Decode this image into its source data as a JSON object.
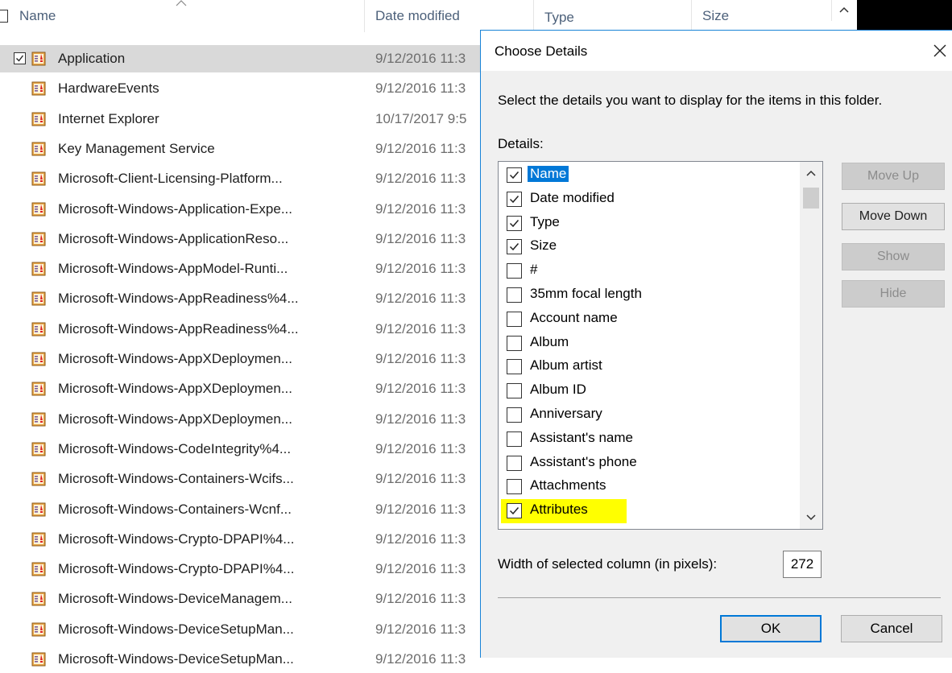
{
  "explorer": {
    "columns": {
      "name": "Name",
      "date_modified": "Date modified",
      "type": "Type",
      "size": "Size"
    },
    "icon_name": "event-log-icon",
    "files": [
      {
        "name": "Application",
        "date": "9/12/2016 11:3",
        "selected": true
      },
      {
        "name": "HardwareEvents",
        "date": "9/12/2016 11:3"
      },
      {
        "name": "Internet Explorer",
        "date": "10/17/2017 9:5"
      },
      {
        "name": "Key Management Service",
        "date": "9/12/2016 11:3"
      },
      {
        "name": "Microsoft-Client-Licensing-Platform...",
        "date": "9/12/2016 11:3"
      },
      {
        "name": "Microsoft-Windows-Application-Expe...",
        "date": "9/12/2016 11:3"
      },
      {
        "name": "Microsoft-Windows-ApplicationReso...",
        "date": "9/12/2016 11:3"
      },
      {
        "name": "Microsoft-Windows-AppModel-Runti...",
        "date": "9/12/2016 11:3"
      },
      {
        "name": "Microsoft-Windows-AppReadiness%4...",
        "date": "9/12/2016 11:3"
      },
      {
        "name": "Microsoft-Windows-AppReadiness%4...",
        "date": "9/12/2016 11:3"
      },
      {
        "name": "Microsoft-Windows-AppXDeploymen...",
        "date": "9/12/2016 11:3"
      },
      {
        "name": "Microsoft-Windows-AppXDeploymen...",
        "date": "9/12/2016 11:3"
      },
      {
        "name": "Microsoft-Windows-AppXDeploymen...",
        "date": "9/12/2016 11:3"
      },
      {
        "name": "Microsoft-Windows-CodeIntegrity%4...",
        "date": "9/12/2016 11:3"
      },
      {
        "name": "Microsoft-Windows-Containers-Wcifs...",
        "date": "9/12/2016 11:3"
      },
      {
        "name": "Microsoft-Windows-Containers-Wcnf...",
        "date": "9/12/2016 11:3"
      },
      {
        "name": "Microsoft-Windows-Crypto-DPAPI%4...",
        "date": "9/12/2016 11:3"
      },
      {
        "name": "Microsoft-Windows-Crypto-DPAPI%4...",
        "date": "9/12/2016 11:3"
      },
      {
        "name": "Microsoft-Windows-DeviceManagem...",
        "date": "9/12/2016 11:3"
      },
      {
        "name": "Microsoft-Windows-DeviceSetupMan...",
        "date": "9/12/2016 11:3"
      },
      {
        "name": "Microsoft-Windows-DeviceSetupMan...",
        "date": "9/12/2016 11:3"
      }
    ]
  },
  "dialog": {
    "title": "Choose Details",
    "instruction": "Select the details you want to display for the items in this folder.",
    "details_label": "Details:",
    "items": [
      {
        "label": "Name",
        "checked": true,
        "selected": true
      },
      {
        "label": "Date modified",
        "checked": true
      },
      {
        "label": "Type",
        "checked": true
      },
      {
        "label": "Size",
        "checked": true
      },
      {
        "label": "#",
        "checked": false
      },
      {
        "label": "35mm focal length",
        "checked": false
      },
      {
        "label": "Account name",
        "checked": false
      },
      {
        "label": "Album",
        "checked": false
      },
      {
        "label": "Album artist",
        "checked": false
      },
      {
        "label": "Album ID",
        "checked": false
      },
      {
        "label": "Anniversary",
        "checked": false
      },
      {
        "label": "Assistant's name",
        "checked": false
      },
      {
        "label": "Assistant's phone",
        "checked": false
      },
      {
        "label": "Attachments",
        "checked": false
      },
      {
        "label": "Attributes",
        "checked": true,
        "highlighted": true
      }
    ],
    "buttons": {
      "move_up": "Move Up",
      "move_down": "Move Down",
      "show": "Show",
      "hide": "Hide",
      "ok": "OK",
      "cancel": "Cancel"
    },
    "width_label": "Width of selected column (in pixels):",
    "width_value": "272",
    "colors": {
      "accent": "#0078d7",
      "highlight": "#ffff00",
      "dialog_bg": "#f0f0f0"
    }
  }
}
